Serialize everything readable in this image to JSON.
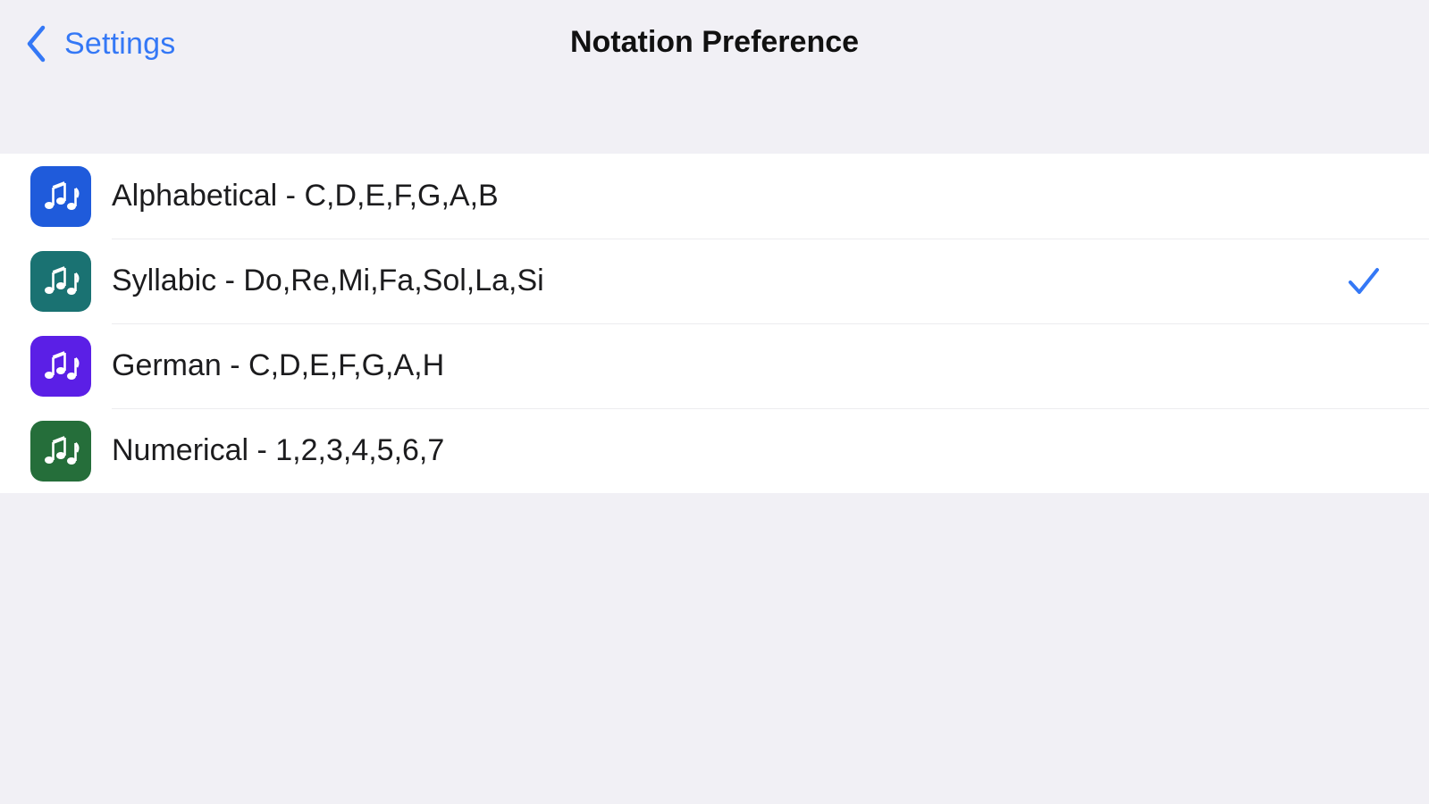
{
  "nav": {
    "back_label": "Settings",
    "title": "Notation Preference"
  },
  "options": [
    {
      "label": "Alphabetical - C,D,E,F,G,A,B",
      "icon": "music-notes-icon",
      "color": "#1f5bdb",
      "selected": false
    },
    {
      "label": "Syllabic - Do,Re,Mi,Fa,Sol,La,Si",
      "icon": "music-notes-icon",
      "color": "#1a7272",
      "selected": true
    },
    {
      "label": "German - C,D,E,F,G,A,H",
      "icon": "music-notes-icon",
      "color": "#5b1fe6",
      "selected": false
    },
    {
      "label": "Numerical - 1,2,3,4,5,6,7",
      "icon": "music-notes-icon",
      "color": "#256e3a",
      "selected": false
    }
  ],
  "colors": {
    "accent": "#3478f6",
    "background": "#f1f0f5",
    "row_background": "#ffffff"
  }
}
